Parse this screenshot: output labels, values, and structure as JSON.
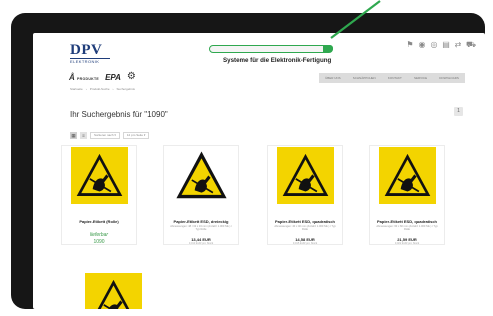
{
  "header": {
    "logo": "DPV",
    "logo_sub": "Elektronik",
    "tagline": "Systeme für die Elektronik-Fertigung",
    "icons": [
      "flag-icon",
      "user-icon",
      "compare-icon",
      "notepad-icon",
      "swap-icon",
      "cart-icon"
    ]
  },
  "brands": {
    "a": "Å",
    "a_sub": "PRODUKTE",
    "b": "EPA",
    "c": "⚙"
  },
  "nav": {
    "items": [
      "Über uns",
      "Schnäppchen",
      "Kontakt",
      "Service",
      "Downloads"
    ]
  },
  "breadcrumb": [
    "Startseite",
    "›",
    "Produkt-Suche",
    "›",
    "Suchergebnis"
  ],
  "search": {
    "value": ""
  },
  "page": {
    "title": "Ihr Suchergebnis für \"1090\"",
    "pager": "1"
  },
  "toolbar": {
    "sort_label": "Sortieren nach ▾",
    "per_page_label": "12 pro Seite ▾"
  },
  "products": [
    {
      "title": "Papier-Etikett (Rolle)",
      "desc": "",
      "price": "",
      "unit": "",
      "availability": "lieferbar",
      "quantity": "1090"
    },
    {
      "title": "Papier-Etikett ESD, dreieckig",
      "desc": "Abmessungen: 48 / 32 x 16 mm (Anzahl: 1.000 Stk.) / Typ Rolle",
      "price": "13,44 EUR",
      "unit": "0,013 EUR pro Stück",
      "availability": "",
      "quantity": ""
    },
    {
      "title": "Papier-Etikett ESD, quadratisch",
      "desc": "Abmessungen: 40 x 40 mm (Anzahl: 1.000 Stk.) / Typ Rolle",
      "price": "14,58 EUR",
      "unit": "0,015 EUR pro Stück",
      "availability": "",
      "quantity": ""
    },
    {
      "title": "Papier-Etikett ESD, quadratisch",
      "desc": "Abmessungen: 60 x 60 mm (Anzahl: 1.000 Stk.) / Typ Rolle",
      "price": "21,59 EUR",
      "unit": "0,022 EUR pro Stück",
      "availability": "",
      "quantity": ""
    }
  ],
  "colors": {
    "accent": "#2fa84f",
    "esd_yellow": "#f3d400",
    "brand_blue": "#1f3d7a"
  }
}
